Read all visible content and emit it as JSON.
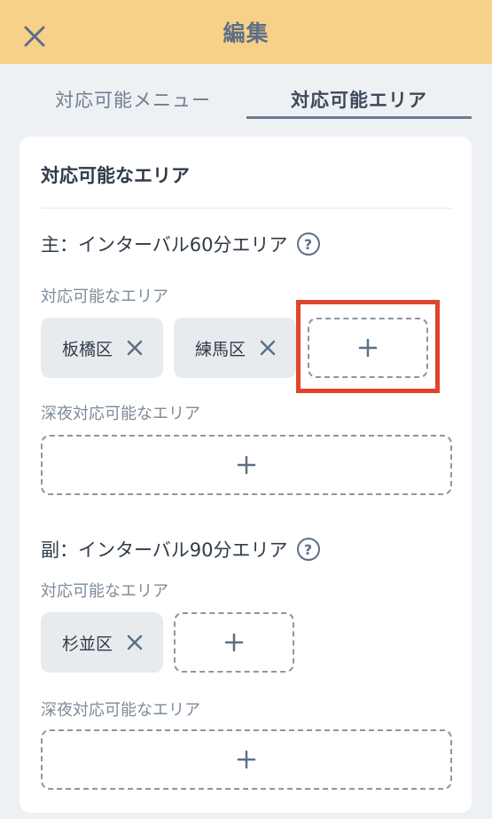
{
  "header": {
    "title": "編集"
  },
  "tabs": [
    {
      "label": "対応可能メニュー",
      "active": false
    },
    {
      "label": "対応可能エリア",
      "active": true
    }
  ],
  "card": {
    "title": "対応可能なエリア",
    "sections": [
      {
        "title": "主：インターバル60分エリア",
        "help": "?",
        "areas_label": "対応可能なエリア",
        "areas": [
          "板橋区",
          "練馬区"
        ],
        "night_label": "深夜対応可能なエリア"
      },
      {
        "title": "副：インターバル90分エリア",
        "help": "?",
        "areas_label": "対応可能なエリア",
        "areas": [
          "杉並区"
        ],
        "night_label": "深夜対応可能なエリア"
      }
    ]
  },
  "colors": {
    "header_bg": "#f7d08a",
    "highlight": "#e0452c",
    "accent": "#5c6f86"
  },
  "icons": [
    "close-icon",
    "help-icon",
    "remove-icon",
    "plus-icon"
  ]
}
